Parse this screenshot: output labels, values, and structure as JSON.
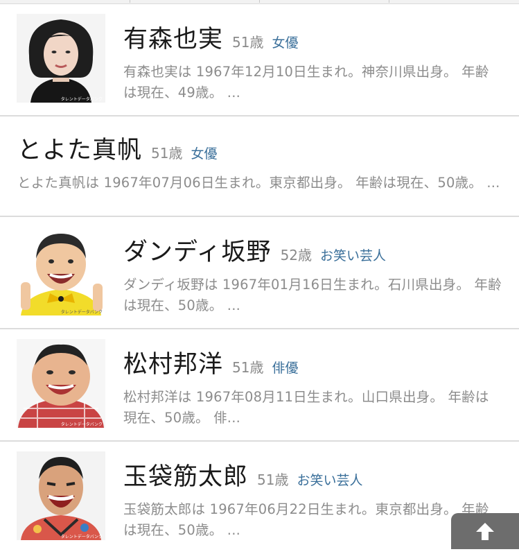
{
  "people": [
    {
      "name": "有森也実",
      "age": "51歳",
      "job": "女優",
      "desc": "有森也実は 1967年12月10日生まれ。神奈川県出身。 年齢は現在、49歳。 ...",
      "photo_badge": "タレントデータバンク"
    },
    {
      "name": "とよた真帆",
      "age": "51歳",
      "job": "女優",
      "desc": "とよた真帆は 1967年07月06日生まれ。東京都出身。 年齢は現在、50歳。 ..."
    },
    {
      "name": "ダンディ坂野",
      "age": "52歳",
      "job": "お笑い芸人",
      "desc": "ダンディ坂野は 1967年01月16日生まれ。石川県出身。 年齢は現在、50歳。 ...",
      "photo_badge": "タレントデータバンク"
    },
    {
      "name": "松村邦洋",
      "age": "51歳",
      "job": "俳優",
      "desc": "松村邦洋は 1967年08月11日生まれ。山口県出身。 年齢は現在、50歳。 俳...",
      "photo_badge": "タレントデータバンク"
    },
    {
      "name": "玉袋筋太郎",
      "age": "51歳",
      "job": "お笑い芸人",
      "desc": "玉袋筋太郎は 1967年06月22日生まれ。東京都出身。 年齢は現在、50歳。 ...",
      "photo_badge": "タレントデータバンク"
    }
  ],
  "colors": {
    "name": "#1a1a1a",
    "meta": "#8a8a8a",
    "job": "#3a6f9a",
    "desc": "#8c8c8c",
    "divider": "#dcdcdc",
    "scroll_button": "#6d6d6d"
  },
  "scroll_top_icon": "arrow-up-icon"
}
